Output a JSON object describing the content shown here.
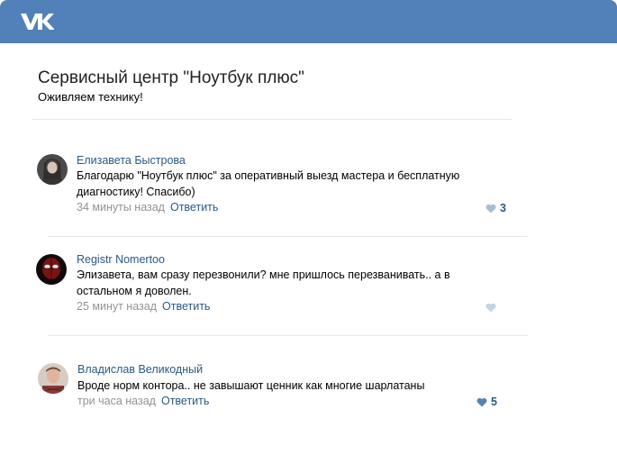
{
  "header": {
    "logo_icon": "vk-logo-icon",
    "color": "#5181b8"
  },
  "page": {
    "title": "Сервисный центр \"Ноутбук плюс\"",
    "subtitle": "Оживляем технику!"
  },
  "comments": [
    {
      "author": "Елизавета Быстрова",
      "text": "Благодарю \"Ноутбук плюс\" за оперативный выезд мастера и бесплатную диагностику! Спасибо)",
      "time": "34 минуты назад",
      "reply": "Ответить",
      "likes": "3"
    },
    {
      "author": "Registr Nomertoo",
      "text": "Элизавета, вам сразу перезвонили? мне пришлось перезванивать.. а в остальном я доволен.",
      "time": "25 минут назад",
      "reply": "Ответить",
      "likes": ""
    },
    {
      "author": "Владислав Великодный",
      "text": "Вроде норм контора.. не завышают ценник как многие шарлатаны",
      "time": "три часа назад",
      "reply": "Ответить",
      "likes": "5"
    }
  ]
}
